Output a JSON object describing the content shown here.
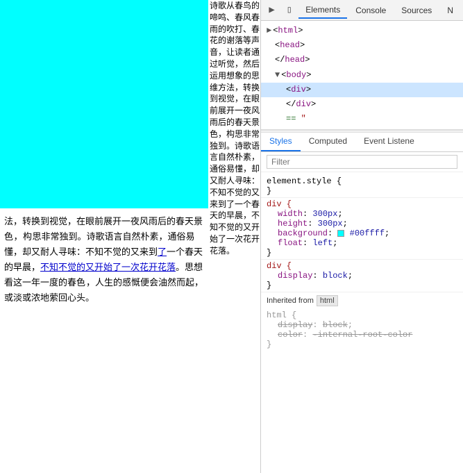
{
  "browser": {
    "text_column": "诗歌从春鸟的啼鸣、春风春雨的吹打、春花的谢落等声音，让读者通过听觉，然后运用想象的思维方法，转换到视觉，在眼前展开一夜风雨后的春天景色，构思非常独到。诗歌语言自然朴素，通俗易懂，却又耐人寻味：不知不觉的又来到了一个春天的早晨，不知不觉的又开始了一次花开花落。思想看这一年一度的春色，人生的感慨便会油然而起，或淡或浓地萦回心头。",
    "bottom_paragraph": "法，转换到视觉，在眼前展开一夜风雨后的春天景色，构思非常独到。诗歌语言自然朴素，通俗易懂，却又耐人寻味：不知不觉的又来到了一个春天的早晨，不知不觉的又开始了一次花开花落。思想看这一年一度的春色，人生的感慨便会油然而起，或淡或浓地萦回心头。",
    "text_side": "诗歌从春鸟的啼鸣、春风春雨的吹打、春花的谢落等声音，让读者通过听觉，然后运用想象的思维方"
  },
  "devtools": {
    "top_tabs": [
      "Elements",
      "Console",
      "Sources",
      "N"
    ],
    "panel_tabs": [
      "Styles",
      "Computed",
      "Event Listene"
    ],
    "filter_placeholder": "Filter",
    "rules": [
      {
        "selector": "element.style {",
        "properties": [],
        "close": "}"
      },
      {
        "selector": "div {",
        "properties": [
          {
            "name": "width",
            "value": "300px"
          },
          {
            "name": "height",
            "value": "300px"
          },
          {
            "name": "background",
            "value": "#00ffff",
            "is_color": true,
            "color_hex": "#00ffff"
          },
          {
            "name": "float",
            "value": "left"
          }
        ],
        "close": "}"
      },
      {
        "selector": "div {",
        "properties": [
          {
            "name": "display",
            "value": "block"
          }
        ],
        "close": "}"
      }
    ],
    "inherited_label": "Inherited from",
    "inherited_tag": "html",
    "inherited_rules": [
      {
        "selector": "html {",
        "properties": [
          {
            "name": "display",
            "value": "block"
          },
          {
            "name": "color",
            "value": "-internal-root-color"
          }
        ],
        "close": "}"
      }
    ]
  },
  "dom": {
    "lines": [
      {
        "text": "<html>",
        "indent": 0,
        "type": "tag"
      },
      {
        "text": "<head>",
        "indent": 1,
        "type": "tag"
      },
      {
        "text": "</head>",
        "indent": 1,
        "type": "tag"
      },
      {
        "text": "<body>",
        "indent": 1,
        "type": "tag",
        "expanded": true
      },
      {
        "text": "<div>",
        "indent": 2,
        "type": "tag",
        "selected": true
      },
      {
        "text": "</div>",
        "indent": 2,
        "type": "tag"
      },
      {
        "text": "== ",
        "indent": 2,
        "type": "comment"
      }
    ]
  }
}
